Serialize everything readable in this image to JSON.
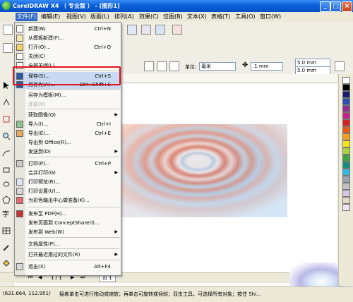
{
  "window": {
    "title": "CorelDRAW X4 （ 专业版 ） - [图形1]"
  },
  "menubar": {
    "items": [
      "文件(F)",
      "编辑(E)",
      "视图(V)",
      "版面(L)",
      "排列(A)",
      "效果(C)",
      "位图(B)",
      "文本(X)",
      "表格(T)",
      "工具(O)",
      "窗口(W)"
    ]
  },
  "toolbar": {
    "units_label": "单位:",
    "units_value": "毫米",
    "nudge_value": ".1 mm",
    "dup_x": "5.0 mm",
    "dup_y": "5.0 mm"
  },
  "file_menu": {
    "items": [
      {
        "label": "新建(N)",
        "shortcut": "Ctrl+N",
        "icon": "new-document-icon"
      },
      {
        "label": "从模板新建(F)...",
        "shortcut": "",
        "icon": "template-icon"
      },
      {
        "label": "打开(O)...",
        "shortcut": "Ctrl+O",
        "icon": "open-folder-icon"
      },
      {
        "label": "关闭(C)",
        "shortcut": "",
        "icon": "close-doc-icon"
      },
      {
        "label": "全部关闭(L)",
        "shortcut": "",
        "icon": "close-all-icon"
      },
      {
        "label": "保存(S)...",
        "shortcut": "Ctrl+S",
        "icon": "save-icon"
      },
      {
        "label": "另存为(A)...",
        "shortcut": "Ctrl+Shift+S",
        "icon": "save-as-icon"
      },
      {
        "label": "另存为模板(M)...",
        "shortcut": "",
        "icon": ""
      },
      {
        "label": "还原(V)",
        "shortcut": "",
        "icon": "",
        "disabled": true
      },
      {
        "label": "获取图像(Q)",
        "shortcut": "",
        "icon": "",
        "submenu": true
      },
      {
        "label": "导入(I)...",
        "shortcut": "Ctrl+I",
        "icon": "import-icon"
      },
      {
        "label": "导出(E)...",
        "shortcut": "Ctrl+E",
        "icon": "export-icon"
      },
      {
        "label": "导出到 Office(R)...",
        "shortcut": "",
        "icon": ""
      },
      {
        "label": "发送到(D)",
        "shortcut": "",
        "icon": "",
        "submenu": true
      },
      {
        "label": "打印(P)...",
        "shortcut": "Ctrl+P",
        "icon": "print-icon"
      },
      {
        "label": "合并打印(G)",
        "shortcut": "",
        "icon": "",
        "submenu": true
      },
      {
        "label": "打印预览(R)...",
        "shortcut": "",
        "icon": "print-preview-icon"
      },
      {
        "label": "打印设置(U)...",
        "shortcut": "",
        "icon": "print-setup-icon"
      },
      {
        "label": "为彩色输出中心做准备(K)...",
        "shortcut": "",
        "icon": "prepare-output-icon"
      },
      {
        "label": "发布至 PDF(H)...",
        "shortcut": "",
        "icon": "pdf-icon"
      },
      {
        "label": "发布页面到 ConceptShare(I)...",
        "shortcut": "",
        "icon": ""
      },
      {
        "label": "发布到 Web(W)",
        "shortcut": "",
        "icon": "",
        "submenu": true
      },
      {
        "label": "文档属性(P)...",
        "shortcut": "",
        "icon": ""
      },
      {
        "label": "打开最近用过的文件(R)",
        "shortcut": "",
        "icon": "",
        "submenu": true
      },
      {
        "label": "退出(X)",
        "shortcut": "Alt+F4",
        "icon": "exit-icon"
      }
    ]
  },
  "page_nav": {
    "page_count": "1 / 1",
    "page_tab": "页 1"
  },
  "status": {
    "coords": "(631.664, 112.951)",
    "hint": "接着单击可进行拖动或缩放；再单击可旋转或倾斜；双击工具，可选择所有对象；按住 Shi..."
  },
  "palette": {
    "colors": [
      "#ffffff",
      "#000000",
      "#1a1a6e",
      "#2f4bb5",
      "#8e2e8e",
      "#c8208a",
      "#d8202a",
      "#e85a14",
      "#f3a11c",
      "#f5e61c",
      "#a8d43c",
      "#3ba33b",
      "#1b8b7e",
      "#35b8e0",
      "#9aa4b0",
      "#c0c0c0",
      "#d8c8e8",
      "#e8d8c8",
      "#f0e0f0"
    ]
  }
}
